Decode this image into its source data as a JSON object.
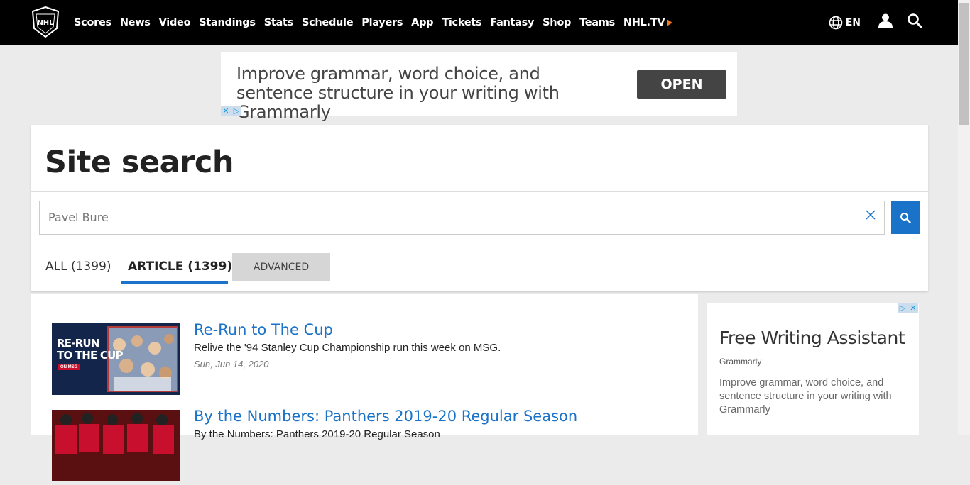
{
  "nav": {
    "links": [
      "Scores",
      "News",
      "Video",
      "Standings",
      "Stats",
      "Schedule",
      "Players",
      "App",
      "Tickets",
      "Fantasy",
      "Shop",
      "Teams"
    ],
    "nhltv": "NHL.TV",
    "lang": "EN"
  },
  "ad_top": {
    "text": "Improve grammar, word choice, and sentence structure in your writing with Grammarly",
    "button": "OPEN"
  },
  "page": {
    "title": "Site search",
    "search_value": "Pavel Bure",
    "tabs": {
      "all": "ALL (1399)",
      "article": "ARTICLE (1399)"
    },
    "advanced": "ADVANCED"
  },
  "results": [
    {
      "title": "Re-Run to The Cup",
      "desc": "Relive the '94 Stanley Cup Championship run this week on MSG.",
      "date": "Sun, Jun 14, 2020",
      "thumb_text": [
        "RE-RUN",
        "TO THE CUP"
      ],
      "thumb_badge": "ON MSG"
    },
    {
      "title": "By the Numbers: Panthers 2019-20 Regular Season",
      "desc": "By the Numbers: Panthers 2019-20 Regular Season",
      "date": ""
    }
  ],
  "side_ad": {
    "headline": "Free Writing Assistant",
    "brand": "Grammarly",
    "desc": "Improve grammar, word choice, and sentence structure in your writing with Grammarly"
  },
  "colors": {
    "accent": "#1a73c8",
    "nhltv_arrow": "#f47a1f",
    "nav_bg": "#000000"
  },
  "icons": [
    "nhl-logo-icon",
    "globe-icon",
    "user-icon",
    "search-icon",
    "clear-icon",
    "adchoices-icon"
  ]
}
